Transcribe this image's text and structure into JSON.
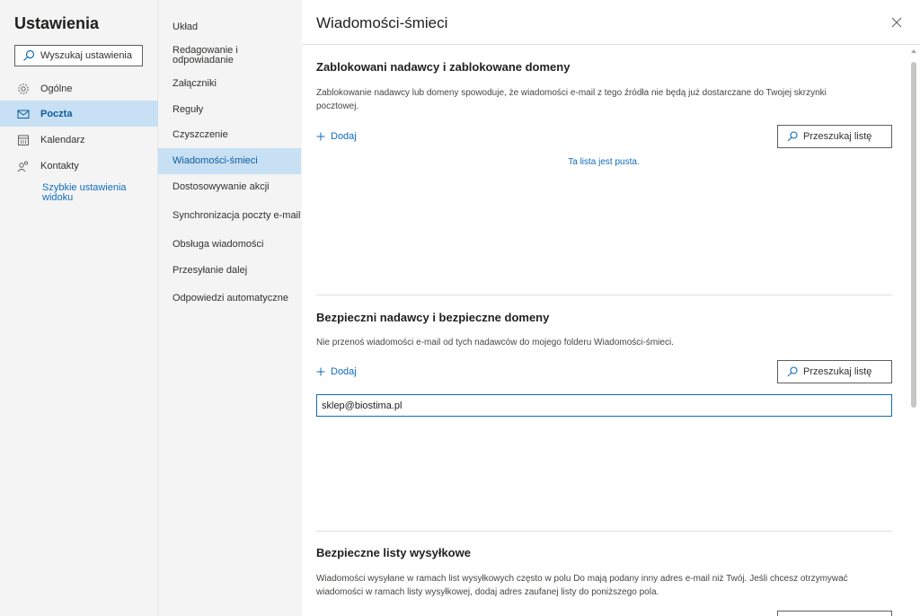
{
  "colors": {
    "accent": "#0078d4",
    "link": "#0f6cbd",
    "active_bg": "#c7e0f4",
    "sidebar_bg": "#f4f4f4"
  },
  "settings": {
    "title": "Ustawienia",
    "search_placeholder": "Wyszukaj ustawienia",
    "nav": [
      {
        "label": "Ogólne",
        "icon": "gear-icon"
      },
      {
        "label": "Poczta",
        "icon": "mail-icon",
        "active": true
      },
      {
        "label": "Kalendarz",
        "icon": "calendar-icon"
      },
      {
        "label": "Kontakty",
        "icon": "people-icon"
      }
    ],
    "quick_link": "Szybkie ustawienia widoku"
  },
  "mail_menu": [
    {
      "label": "Układ"
    },
    {
      "label": "Redagowanie i odpowiadanie"
    },
    {
      "label": "Załączniki"
    },
    {
      "label": "Reguły"
    },
    {
      "label": "Czyszczenie"
    },
    {
      "label": "Wiadomości-śmieci",
      "active": true
    },
    {
      "label": "Dostosowywanie akcji"
    },
    {
      "label": "Synchronizacja poczty e-mail"
    },
    {
      "label": "Obsługa wiadomości"
    },
    {
      "label": "Przesyłanie dalej"
    },
    {
      "label": "Odpowiedzi automatyczne"
    }
  ],
  "panel": {
    "title": "Wiadomości-śmieci",
    "close_icon": "close-icon",
    "blocked": {
      "title": "Zablokowani nadawcy i zablokowane domeny",
      "desc": "Zablokowanie nadawcy lub domeny spowoduje, że wiadomości e-mail z tego źródła nie będą już dostarczane do Twojej skrzynki pocztowej.",
      "add_label": "Dodaj",
      "search_label": "Przeszukaj listę",
      "empty_text": "Ta lista jest pusta."
    },
    "safe": {
      "title": "Bezpieczni nadawcy i bezpieczne domeny",
      "desc": "Nie przenoś wiadomości e-mail od tych nadawców do mojego folderu Wiadomości-śmieci.",
      "add_label": "Dodaj",
      "search_label": "Przeszukaj listę",
      "entry_value": "sklep@biostima.pl"
    },
    "mailing": {
      "title": "Bezpieczne listy wysyłkowe",
      "desc": "Wiadomości wysyłane w ramach list wysyłkowych często w polu Do mają podany inny adres e-mail niż Twój. Jeśli chcesz otrzymywać wiadomości w ramach listy wysyłkowej, dodaj adres zaufanej listy do poniższego pola."
    }
  }
}
